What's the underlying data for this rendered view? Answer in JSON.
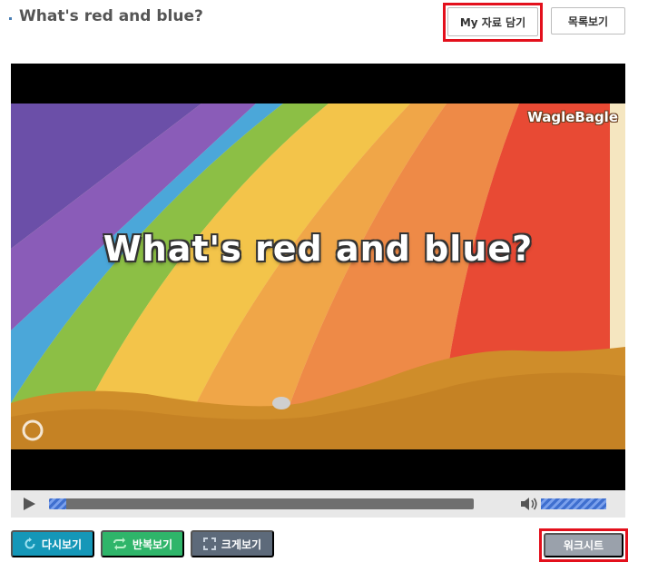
{
  "header": {
    "title": "What's red and blue?",
    "my_save_label": "My 자료 담기",
    "list_label": "목록보기"
  },
  "video": {
    "logo": "WagleBagle",
    "caption": "What's red and blue?",
    "progress": 0.04,
    "volume": 1.0
  },
  "actions": {
    "replay_label": "다시보기",
    "repeat_label": "반복보기",
    "enlarge_label": "크게보기",
    "worksheet_label": "워크시트"
  },
  "colors": {
    "highlight": "#e3101c",
    "replay": "#1597b8",
    "repeat": "#2fb56a",
    "enlarge": "#5d6a7a",
    "worksheet": "#9aa1ab"
  }
}
